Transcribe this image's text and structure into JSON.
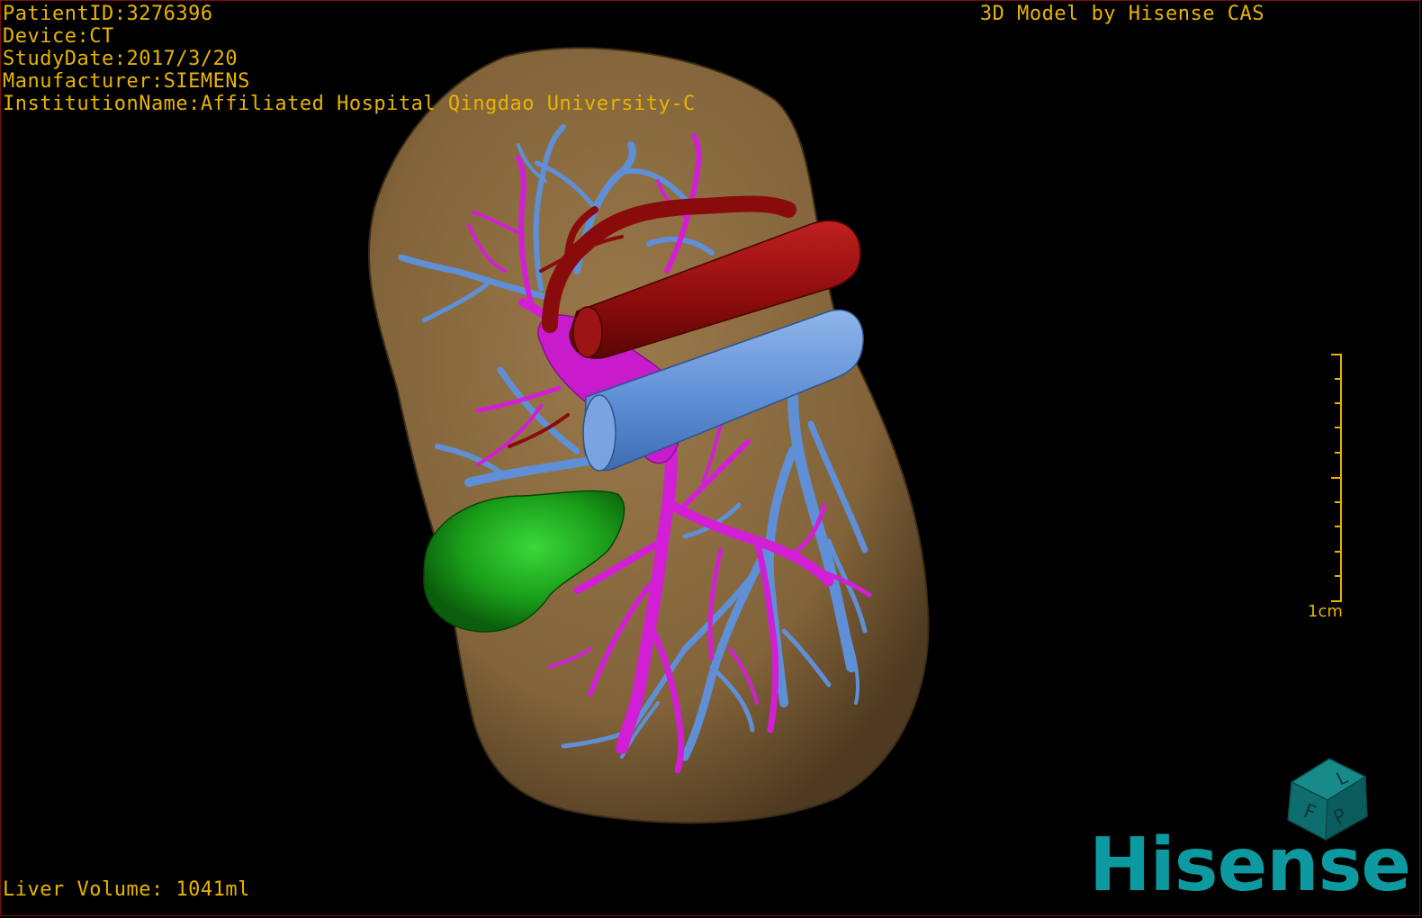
{
  "header": {
    "patient_id": "PatientID:3276396",
    "device": "Device:CT",
    "study_date": "StudyDate:2017/3/20",
    "manufacturer": "Manufacturer:SIEMENS",
    "institution": "InstitutionName:Affiliated Hospital Qingdao University-C"
  },
  "credit": "3D Model by Hisense CAS",
  "footer": {
    "liver_volume": "Liver Volume: 1041ml"
  },
  "scale_bar": {
    "label": "1cm"
  },
  "orientation_cube": {
    "labels": [
      "F",
      "L",
      "P"
    ],
    "color": "#0e6e6e"
  },
  "logo": "Hisense",
  "colors": {
    "overlay_text": "#e8b400",
    "liver": "#8a6a3c",
    "hepatic_vein": "#5f8fd6",
    "portal_vein": "#d21fd6",
    "artery": "#8a0b0b",
    "tumor": "#1a9e1a",
    "logo": "#0c9aa0"
  }
}
